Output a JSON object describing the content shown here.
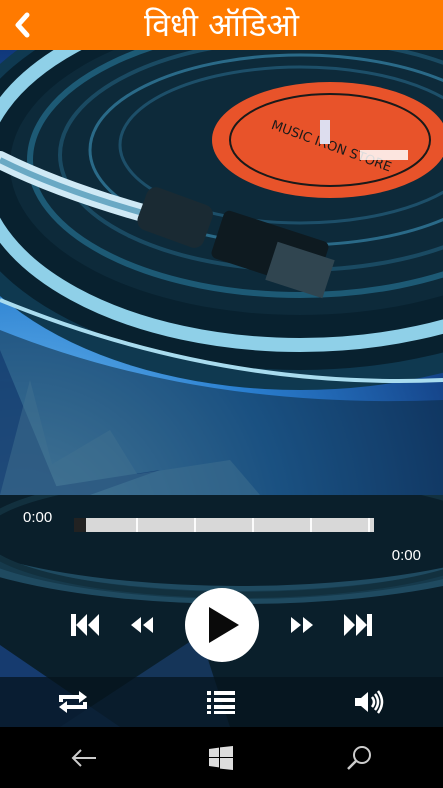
{
  "header": {
    "title": "विधी ऑडिओ",
    "back_icon": "chevron-left-icon",
    "bg_color": "#ff7a00"
  },
  "album_art": {
    "label_text": "MUSIC IRON STORE",
    "icon": "turntable-record-image"
  },
  "player": {
    "current_time": "0:00",
    "total_time": "0:00",
    "progress": 0,
    "controls": {
      "skip_previous_icon": "skip-previous-icon",
      "rewind_icon": "rewind-icon",
      "play_icon": "play-icon",
      "fast_forward_icon": "fast-forward-icon",
      "skip_next_icon": "skip-next-icon"
    }
  },
  "toolbar": {
    "repeat_icon": "repeat-icon",
    "playlist_icon": "playlist-icon",
    "volume_icon": "volume-icon"
  },
  "system_nav": {
    "back_icon": "back-arrow-icon",
    "home_icon": "windows-logo-icon",
    "search_icon": "search-icon"
  }
}
